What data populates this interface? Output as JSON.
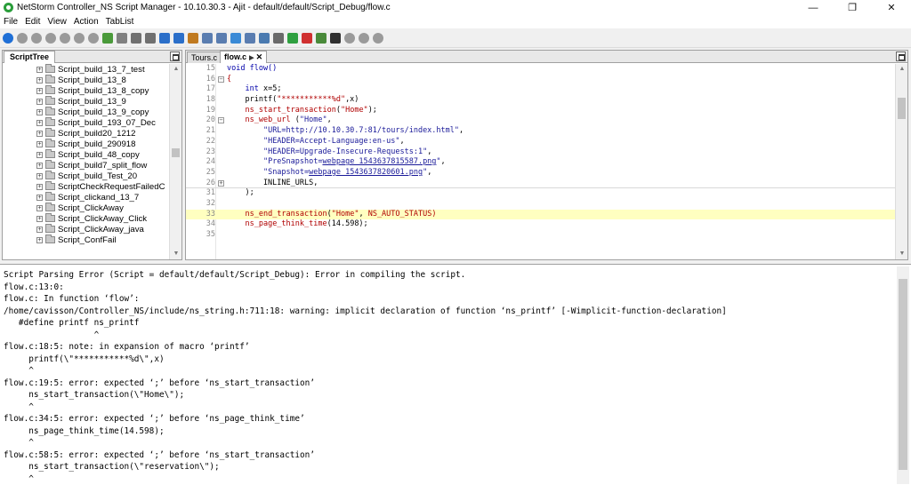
{
  "window": {
    "title": "NetStorm Controller_NS Script Manager - 10.10.30.3 - Ajit -  default/default/Script_Debug/flow.c",
    "minimize": "—",
    "restore": "❐",
    "close": "✕"
  },
  "menu": [
    "File",
    "Edit",
    "View",
    "Action",
    "TabList"
  ],
  "toolbar_icons": [
    {
      "name": "run-icon",
      "color": "#1f6fd6"
    },
    {
      "name": "stop-icon",
      "color": "#9a9a9a"
    },
    {
      "name": "record-icon",
      "color": "#9a9a9a"
    },
    {
      "name": "pause-icon",
      "color": "#9a9a9a"
    },
    {
      "name": "step-icon",
      "color": "#9a9a9a"
    },
    {
      "name": "debug-icon",
      "color": "#9a9a9a"
    },
    {
      "name": "comment-icon",
      "color": "#9a9a9a"
    },
    {
      "name": "new-script-icon",
      "color": "#4a9a3a"
    },
    {
      "name": "save-icon",
      "color": "#808080"
    },
    {
      "name": "copy-icon",
      "color": "#707070"
    },
    {
      "name": "paste-icon",
      "color": "#707070"
    },
    {
      "name": "download-icon",
      "color": "#2b6fc9"
    },
    {
      "name": "upload-icon",
      "color": "#2b6fc9"
    },
    {
      "name": "settings-icon",
      "color": "#c07a20"
    },
    {
      "name": "find-icon",
      "color": "#5a7db0"
    },
    {
      "name": "replace-icon",
      "color": "#5a7db0"
    },
    {
      "name": "select-icon",
      "color": "#3a8ad6"
    },
    {
      "name": "compile-icon",
      "color": "#5a7db0"
    },
    {
      "name": "image-icon",
      "color": "#4a7ab0"
    },
    {
      "name": "report-icon",
      "color": "#6a6a6a"
    },
    {
      "name": "refresh-icon",
      "color": "#2fa040"
    },
    {
      "name": "alarm-icon",
      "color": "#d03030"
    },
    {
      "name": "export-icon",
      "color": "#4a8a3a"
    },
    {
      "name": "disk-icon",
      "color": "#303030"
    },
    {
      "name": "disabled1-icon",
      "color": "#9a9a9a"
    },
    {
      "name": "disabled2-icon",
      "color": "#9a9a9a"
    },
    {
      "name": "disabled3-icon",
      "color": "#9a9a9a"
    }
  ],
  "left_panel": {
    "tab": "ScriptTree",
    "items": [
      "Script_build_13_7_test",
      "Script_build_13_8",
      "Script_build_13_8_copy",
      "Script_build_13_9",
      "Script_build_13_9_copy",
      "Script_build_193_07_Dec",
      "Script_build20_1212",
      "Script_build_290918",
      "Script_build_48_copy",
      "Script_build7_split_flow",
      "Script_build_Test_20",
      "ScriptCheckRequestFailedC",
      "Script_clickand_13_7",
      "Script_ClickAway",
      "Script_ClickAway_Click",
      "Script_ClickAway_java",
      "Script_ConfFail"
    ]
  },
  "editor": {
    "tabs": [
      {
        "label": "Tours.c",
        "active": false
      },
      {
        "label": "flow.c",
        "active": true
      }
    ],
    "lines": [
      {
        "num": "15",
        "fold": "",
        "sep": false,
        "hl": false,
        "parts": [
          {
            "t": "void flow()",
            "c": "kw"
          }
        ]
      },
      {
        "num": "16",
        "fold": "−",
        "sep": false,
        "hl": false,
        "parts": [
          {
            "t": "{",
            "c": "fn"
          }
        ]
      },
      {
        "num": "17",
        "fold": "",
        "sep": false,
        "hl": false,
        "parts": [
          {
            "t": "    "
          },
          {
            "t": "int",
            "c": "kw"
          },
          {
            "t": " x=5;"
          }
        ]
      },
      {
        "num": "18",
        "fold": "",
        "sep": false,
        "hl": false,
        "parts": [
          {
            "t": "    printf("
          },
          {
            "t": "\"***********%d\"",
            "c": "fn"
          },
          {
            "t": ",x)"
          }
        ]
      },
      {
        "num": "19",
        "fold": "",
        "sep": false,
        "hl": false,
        "parts": [
          {
            "t": "    "
          },
          {
            "t": "ns_start_transaction",
            "c": "fn"
          },
          {
            "t": "("
          },
          {
            "t": "\"Home\"",
            "c": "fn"
          },
          {
            "t": ");"
          }
        ]
      },
      {
        "num": "20",
        "fold": "−",
        "sep": false,
        "hl": false,
        "parts": [
          {
            "t": "    "
          },
          {
            "t": "ns_web_url",
            "c": "fn"
          },
          {
            "t": " ("
          },
          {
            "t": "\"Home\"",
            "c": "str"
          },
          {
            "t": ","
          }
        ]
      },
      {
        "num": "21",
        "fold": "",
        "sep": false,
        "hl": false,
        "parts": [
          {
            "t": "        "
          },
          {
            "t": "\"URL=http://10.10.30.7:81/tours/index.html\"",
            "c": "str"
          },
          {
            "t": ","
          }
        ]
      },
      {
        "num": "22",
        "fold": "",
        "sep": false,
        "hl": false,
        "parts": [
          {
            "t": "        "
          },
          {
            "t": "\"HEADER=Accept-Language:en-us\"",
            "c": "str"
          },
          {
            "t": ","
          }
        ]
      },
      {
        "num": "23",
        "fold": "",
        "sep": false,
        "hl": false,
        "parts": [
          {
            "t": "        "
          },
          {
            "t": "\"HEADER=Upgrade-Insecure-Requests:1\"",
            "c": "str"
          },
          {
            "t": ","
          }
        ]
      },
      {
        "num": "24",
        "fold": "",
        "sep": false,
        "hl": false,
        "parts": [
          {
            "t": "        "
          },
          {
            "t": "\"PreSnapshot=",
            "c": "str"
          },
          {
            "t": "webpage_1543637815587.png",
            "c": "str u"
          },
          {
            "t": "\"",
            "c": "str"
          },
          {
            "t": ","
          }
        ]
      },
      {
        "num": "25",
        "fold": "",
        "sep": false,
        "hl": false,
        "parts": [
          {
            "t": "        "
          },
          {
            "t": "\"Snapshot=",
            "c": "str"
          },
          {
            "t": "webpage_1543637820601.png",
            "c": "str u"
          },
          {
            "t": "\"",
            "c": "str"
          },
          {
            "t": ","
          }
        ]
      },
      {
        "num": "26",
        "fold": "+",
        "sep": true,
        "hl": false,
        "parts": [
          {
            "t": "        INLINE_URLS,"
          }
        ]
      },
      {
        "num": "31",
        "fold": "",
        "sep": false,
        "hl": false,
        "parts": [
          {
            "t": "    );"
          }
        ]
      },
      {
        "num": "32",
        "fold": "",
        "sep": false,
        "hl": false,
        "parts": [
          {
            "t": ""
          }
        ]
      },
      {
        "num": "33",
        "fold": "",
        "sep": false,
        "hl": true,
        "parts": [
          {
            "t": "    "
          },
          {
            "t": "ns_end_transaction",
            "c": "fn"
          },
          {
            "t": "("
          },
          {
            "t": "\"Home\"",
            "c": "fn"
          },
          {
            "t": ", "
          },
          {
            "t": "NS_AUTO_STATUS)",
            "c": "fn"
          }
        ]
      },
      {
        "num": "34",
        "fold": "",
        "sep": false,
        "hl": false,
        "parts": [
          {
            "t": "    "
          },
          {
            "t": "ns_page_think_time",
            "c": "fn"
          },
          {
            "t": "(14.598);"
          }
        ]
      },
      {
        "num": "35",
        "fold": "",
        "sep": false,
        "hl": false,
        "parts": [
          {
            "t": ""
          }
        ]
      }
    ]
  },
  "output": {
    "lines": [
      "Script Parsing Error (Script = default/default/Script_Debug): Error in compiling the script.",
      "flow.c:13:0:",
      "flow.c: In function ‘flow’:",
      "/home/cavisson/Controller_NS/include/ns_string.h:711:18: warning: implicit declaration of function ‘ns_printf’ [-Wimplicit-function-declaration]",
      "   #define printf ns_printf",
      "                  ^",
      "flow.c:18:5: note: in expansion of macro ‘printf’",
      "     printf(\\\"***********%d\\\",x)",
      "     ^",
      "flow.c:19:5: error: expected ‘;’ before ‘ns_start_transaction’",
      "     ns_start_transaction(\\\"Home\\\");",
      "     ^",
      "flow.c:34:5: error: expected ‘;’ before ‘ns_page_think_time’",
      "     ns_page_think_time(14.598);",
      "     ^",
      "flow.c:58:5: error: expected ‘;’ before ‘ns_start_transaction’",
      "     ns_start_transaction(\\\"reservation\\\");",
      "     ^"
    ]
  }
}
